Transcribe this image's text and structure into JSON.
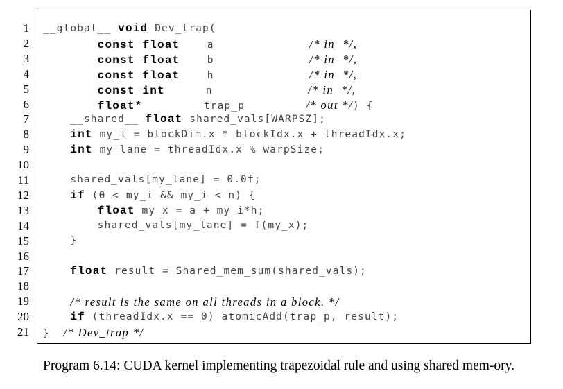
{
  "listing": {
    "lines": [
      {
        "num": "1",
        "parts": [
          [
            "t",
            "__global__ "
          ],
          [
            "k",
            "void"
          ],
          [
            "t",
            " Dev_trap("
          ]
        ]
      },
      {
        "num": "2",
        "parts": [
          [
            "t",
            "        "
          ],
          [
            "k",
            "const float"
          ],
          [
            "t",
            "    a              "
          ],
          [
            "c",
            "/* in  */,"
          ]
        ]
      },
      {
        "num": "3",
        "parts": [
          [
            "t",
            "        "
          ],
          [
            "k",
            "const float"
          ],
          [
            "t",
            "    b              "
          ],
          [
            "c",
            "/* in  */,"
          ]
        ]
      },
      {
        "num": "4",
        "parts": [
          [
            "t",
            "        "
          ],
          [
            "k",
            "const float"
          ],
          [
            "t",
            "    h              "
          ],
          [
            "c",
            "/* in  */,"
          ]
        ]
      },
      {
        "num": "5",
        "parts": [
          [
            "t",
            "        "
          ],
          [
            "k",
            "const int"
          ],
          [
            "t",
            "      n              "
          ],
          [
            "c",
            "/* in  */,"
          ]
        ]
      },
      {
        "num": "6",
        "parts": [
          [
            "t",
            "        "
          ],
          [
            "k",
            "float*"
          ],
          [
            "t",
            "         trap_p         "
          ],
          [
            "c",
            "/* out */"
          ],
          [
            "t",
            ") {"
          ]
        ]
      },
      {
        "num": "7",
        "parts": [
          [
            "t",
            "    __shared__ "
          ],
          [
            "k",
            "float"
          ],
          [
            "t",
            " shared_vals[WARPSZ];"
          ]
        ]
      },
      {
        "num": "8",
        "parts": [
          [
            "t",
            "    "
          ],
          [
            "k",
            "int"
          ],
          [
            "t",
            " my_i = blockDim.x * blockIdx.x + threadIdx.x;"
          ]
        ]
      },
      {
        "num": "9",
        "parts": [
          [
            "t",
            "    "
          ],
          [
            "k",
            "int"
          ],
          [
            "t",
            " my_lane = threadIdx.x % warpSize;"
          ]
        ]
      },
      {
        "num": "10",
        "parts": []
      },
      {
        "num": "11",
        "parts": [
          [
            "t",
            "    shared_vals[my_lane] = 0.0f;"
          ]
        ]
      },
      {
        "num": "12",
        "parts": [
          [
            "t",
            "    "
          ],
          [
            "k",
            "if"
          ],
          [
            "t",
            " (0 < my_i && my_i < n) {"
          ]
        ]
      },
      {
        "num": "13",
        "parts": [
          [
            "t",
            "        "
          ],
          [
            "k",
            "float"
          ],
          [
            "t",
            " my_x = a + my_i*h;"
          ]
        ]
      },
      {
        "num": "14",
        "parts": [
          [
            "t",
            "        shared_vals[my_lane] = f(my_x);"
          ]
        ]
      },
      {
        "num": "15",
        "parts": [
          [
            "t",
            "    }"
          ]
        ]
      },
      {
        "num": "16",
        "parts": []
      },
      {
        "num": "17",
        "parts": [
          [
            "t",
            "    "
          ],
          [
            "k",
            "float"
          ],
          [
            "t",
            " result = Shared_mem_sum(shared_vals);"
          ]
        ]
      },
      {
        "num": "18",
        "parts": []
      },
      {
        "num": "19",
        "parts": [
          [
            "t",
            "    "
          ],
          [
            "c",
            "/* result is the same on all threads in a block. */"
          ]
        ]
      },
      {
        "num": "20",
        "parts": [
          [
            "t",
            "    "
          ],
          [
            "k",
            "if"
          ],
          [
            "t",
            " (threadIdx.x == 0) atomicAdd(trap_p, result);"
          ]
        ]
      },
      {
        "num": "21",
        "parts": [
          [
            "t",
            "}  "
          ],
          [
            "c",
            "/* Dev_trap */"
          ]
        ]
      }
    ]
  },
  "caption": {
    "text": "Program 6.14: CUDA kernel implementing trapezoidal rule and using shared mem-ory."
  }
}
